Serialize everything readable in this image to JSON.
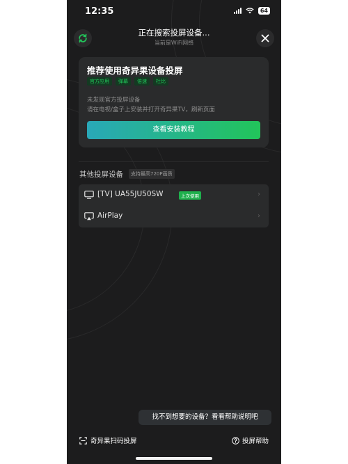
{
  "status_bar": {
    "time": "12:35",
    "battery": "64"
  },
  "header": {
    "title": "正在搜索投屏设备...",
    "subtitle": "当前是WiFi网络"
  },
  "promo_card": {
    "title": "推荐使用奇异果设备投屏",
    "tags": [
      "官方应用",
      "弹幕",
      "倍速",
      "杜比"
    ],
    "line1": "未发现官方投屏设备",
    "line2": "请在电视/盒子上安装并打开奇异果TV，刷新页面",
    "button_label": "查看安装教程"
  },
  "other_devices": {
    "title": "其他投屏设备",
    "badge": "支持最高720P画质",
    "items": [
      {
        "name": "[TV] UA55JU50SW",
        "badge": "上次使用",
        "icon": "tv-icon"
      },
      {
        "name": "AirPlay",
        "badge": "",
        "icon": "airplay-icon"
      }
    ]
  },
  "tooltip": "找不到想要的设备？看看帮助说明吧",
  "bottom_bar": {
    "scan_label": "奇异果扫码投屏",
    "help_label": "投屏帮助"
  },
  "colors": {
    "background": "#1c1c1d",
    "card": "#2a2b2c",
    "accent_green": "#22c45a",
    "accent_teal": "#29a8b8"
  }
}
